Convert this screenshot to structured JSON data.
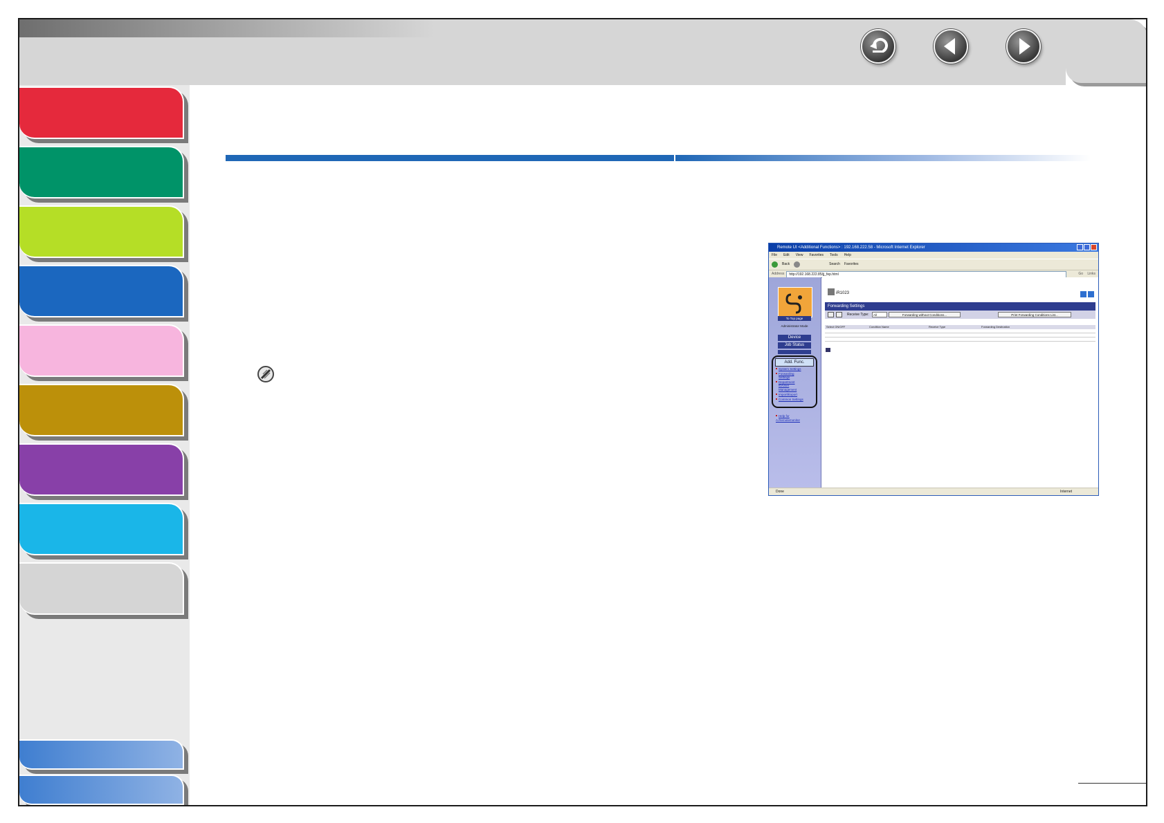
{
  "nav": {
    "back_icon": "return-icon",
    "prev_icon": "prev-page-icon",
    "next_icon": "next-page-icon"
  },
  "sidebar": {
    "colors": [
      "#e5293c",
      "#009368",
      "#b5de26",
      "#1b67bf",
      "#f7b5de",
      "#bc900a",
      "#8840a8",
      "#1ab6e8",
      "#d5d5d5"
    ]
  },
  "screenshot": {
    "window_title": "Remote UI <Additional Functions> : 192.168.222.58 - Microsoft Internet Explorer",
    "menu": [
      "File",
      "Edit",
      "View",
      "Favorites",
      "Tools",
      "Help"
    ],
    "toolbar": [
      "Back",
      "Search",
      "Favorites"
    ],
    "address_label": "Address",
    "address_value": "http://192.168.222.85/jj_fep.html",
    "go_label": "Go",
    "links_label": "Links",
    "left": {
      "top_page_label": "To Top page",
      "mode_label": "Administrator Mode",
      "device_btn": "Device",
      "job_status_btn": "Job Status",
      "addfunc_btn": "Add. Func.",
      "links": [
        "System Settings",
        "Forwarding",
        "Settings",
        "Department",
        "ID/User",
        "Management",
        "Import/Export",
        "Common Settings"
      ],
      "help_link_1": "Help for",
      "help_link_2": "A.Remotemonitor"
    },
    "main": {
      "device_name": "iR1023",
      "section_title": "Forwarding Settings",
      "receive_type_label": "Receive Type:",
      "receive_type_value": "All",
      "btn_without_conditions": "Forwarding without Conditions...",
      "btn_print_list": "Print Forwarding Conditions List...",
      "columns": [
        "Select  ON/OFF",
        "Condition Name",
        "Receive Type",
        "Forwarding Destination"
      ]
    },
    "status_left": "Done",
    "status_right": "Internet"
  }
}
